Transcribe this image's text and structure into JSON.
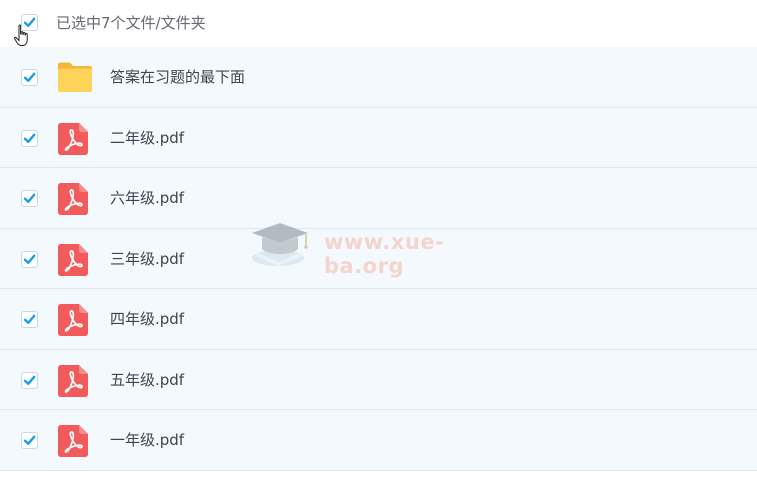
{
  "header": {
    "select_all_label": "已选中7个文件/文件夹",
    "select_all_checked": true
  },
  "files": [
    {
      "name": "答案在习题的最下面",
      "type": "folder",
      "checked": true
    },
    {
      "name": "二年级.pdf",
      "type": "pdf",
      "checked": true
    },
    {
      "name": "六年级.pdf",
      "type": "pdf",
      "checked": true
    },
    {
      "name": "三年级.pdf",
      "type": "pdf",
      "checked": true
    },
    {
      "name": "四年级.pdf",
      "type": "pdf",
      "checked": true
    },
    {
      "name": "五年级.pdf",
      "type": "pdf",
      "checked": true
    },
    {
      "name": "一年级.pdf",
      "type": "pdf",
      "checked": true
    }
  ],
  "watermark": {
    "text": "www.xue-ba.org"
  },
  "colors": {
    "accent_check": "#1a9ee8",
    "pdf_red": "#f25b5b",
    "folder_yellow": "#ffd25a",
    "row_bg": "#f4f9fe"
  },
  "icons": {
    "folder": "folder-icon",
    "pdf": "pdf-file-icon",
    "cursor": "hand-pointer-icon"
  }
}
